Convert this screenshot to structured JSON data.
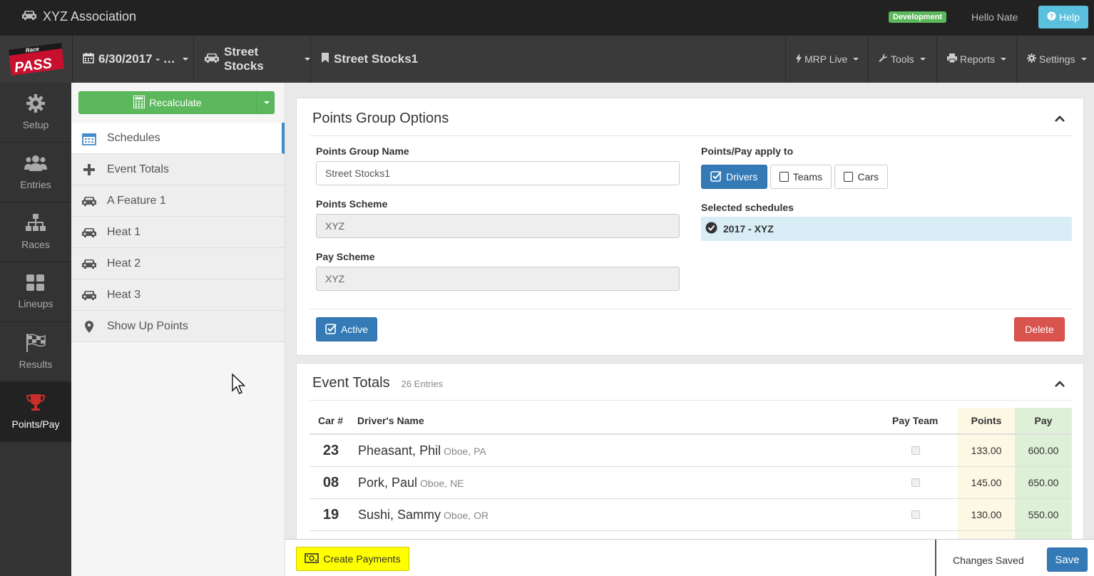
{
  "topbar": {
    "brand": "XYZ Association",
    "env_badge": "Development",
    "greeting": "Hello Nate",
    "help_label": "Help"
  },
  "navbar": {
    "date": "6/30/2017 - …",
    "class": "Street Stocks",
    "points_group": "Street Stocks1",
    "menus": [
      "MRP Live",
      "Tools",
      "Reports",
      "Settings"
    ]
  },
  "leftnav": {
    "items": [
      {
        "label": "Setup",
        "icon": "gear-icon"
      },
      {
        "label": "Entries",
        "icon": "users-icon"
      },
      {
        "label": "Races",
        "icon": "sitemap-icon"
      },
      {
        "label": "Lineups",
        "icon": "grid-icon"
      },
      {
        "label": "Results",
        "icon": "flag-checkered-icon"
      },
      {
        "label": "Points/Pay",
        "icon": "trophy-icon"
      }
    ],
    "active_index": 5
  },
  "sidebar": {
    "recalculate_label": "Recalculate",
    "items": [
      {
        "label": "Schedules",
        "icon": "calendar-icon"
      },
      {
        "label": "Event Totals",
        "icon": "plus-icon"
      },
      {
        "label": "A Feature 1",
        "icon": "car-icon"
      },
      {
        "label": "Heat 1",
        "icon": "car-icon"
      },
      {
        "label": "Heat 2",
        "icon": "car-icon"
      },
      {
        "label": "Heat 3",
        "icon": "car-icon"
      },
      {
        "label": "Show Up Points",
        "icon": "map-marker-icon"
      }
    ],
    "active_index": 0
  },
  "options": {
    "title": "Points Group Options",
    "name_label": "Points Group Name",
    "name_value": "Street Stocks1",
    "scheme_label": "Points Scheme",
    "scheme_value": "XYZ",
    "pay_label": "Pay Scheme",
    "pay_value": "XYZ",
    "apply_label": "Points/Pay apply to",
    "apply_options": [
      {
        "label": "Drivers",
        "checked": true
      },
      {
        "label": "Teams",
        "checked": false
      },
      {
        "label": "Cars",
        "checked": false
      }
    ],
    "schedules_label": "Selected schedules",
    "selected_schedule": "2017 - XYZ",
    "active_label": "Active",
    "delete_label": "Delete"
  },
  "event_totals": {
    "title": "Event Totals",
    "entries": "26 Entries",
    "headers": {
      "car": "Car #",
      "driver": "Driver's Name",
      "pay_team": "Pay Team",
      "points": "Points",
      "pay": "Pay"
    },
    "rows": [
      {
        "car": "23",
        "name": "Pheasant, Phil",
        "location": "Oboe, PA",
        "points": "133.00",
        "pay": "600.00"
      },
      {
        "car": "08",
        "name": "Pork, Paul",
        "location": "Oboe, NE",
        "points": "145.00",
        "pay": "650.00"
      },
      {
        "car": "19",
        "name": "Sushi, Sammy",
        "location": "Oboe, OR",
        "points": "130.00",
        "pay": "550.00"
      }
    ]
  },
  "footer": {
    "create_payments": "Create Payments",
    "status": "Changes Saved",
    "save": "Save"
  },
  "colors": {
    "primary": "#337ab7",
    "success": "#5cb85c",
    "danger": "#d9534f",
    "info": "#5bc0de",
    "highlight": "#ffff00"
  }
}
